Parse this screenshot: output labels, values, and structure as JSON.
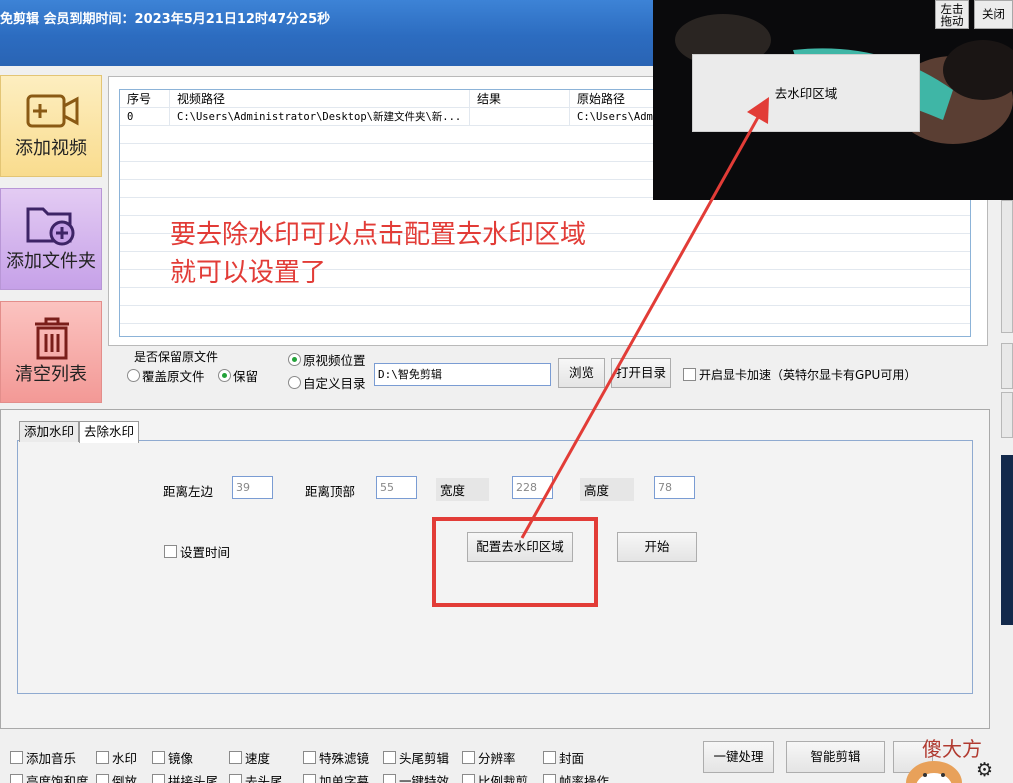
{
  "titlebar": {
    "title": "免剪辑  会员到期时间：2023年5月21日12时47分25秒"
  },
  "sidebar": {
    "add_video": "添加视频",
    "add_folder": "添加文件夹",
    "clear_list": "清空列表"
  },
  "table": {
    "columns": [
      "序号",
      "视频路径",
      "结果",
      "原始路径"
    ],
    "rows": [
      [
        "0",
        "C:\\Users\\Administrator\\Desktop\\新建文件夹\\新...",
        "",
        "C:\\Users\\Admi"
      ]
    ]
  },
  "annotation": {
    "line1": "要去除水印可以点击配置去水印区域",
    "line2": "就可以设置了"
  },
  "keep_original": {
    "label": "是否保留原文件",
    "overwrite": "覆盖原文件",
    "keep": "保留",
    "selected": "保留"
  },
  "output": {
    "original_location": "原视频位置",
    "custom_dir": "自定义目录",
    "selected": "原视频位置",
    "path_value": "D:\\智免剪辑",
    "browse": "浏览",
    "open_dir": "打开目录",
    "gpu_label": "开启显卡加速（英特尔显卡有GPU可用）"
  },
  "tabs": {
    "add_watermark": "添加水印",
    "remove_watermark": "去除水印",
    "active": "去除水印"
  },
  "remove_panel": {
    "left_label": "距离左边",
    "left_value": "39",
    "top_label": "距离顶部",
    "top_value": "55",
    "width_label": "宽度",
    "width_value": "228",
    "height_label": "高度",
    "height_value": "78",
    "set_time": "设置时间",
    "config_button": "配置去水印区域",
    "start_button": "开始"
  },
  "preview": {
    "region_label": "去水印区域",
    "drag_button": "左击\n拖动",
    "close_button": "关闭"
  },
  "bottom": {
    "row1": [
      "添加音乐",
      "水印",
      "镜像",
      "速度",
      "特殊滤镜",
      "头尾剪辑",
      "分辨率",
      "封面"
    ],
    "row2": [
      "亮度饱和度",
      "倒放",
      "拼接头尾",
      "去头尾",
      "加单字幕",
      "一键特效",
      "比例裁剪",
      "帧率操作"
    ],
    "batch_button": "一键处理",
    "smart_button": "智能剪辑",
    "watermark_brand": "傻大方"
  },
  "colors": {
    "titlebar": "#2c6cc0",
    "annotation": "#e23c37",
    "add_video": "#f9dc8e",
    "add_folder": "#c6a1e8",
    "clear_list": "#f39996"
  },
  "icons": [
    "video-add-icon",
    "folder-add-icon",
    "trash-icon",
    "gear-icon",
    "arrow-annotation"
  ]
}
